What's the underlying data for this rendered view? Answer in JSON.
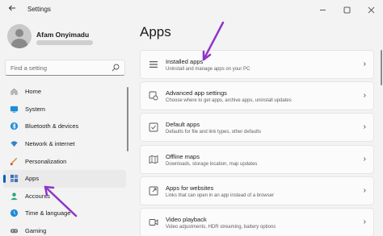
{
  "window": {
    "title": "Settings",
    "back_icon": "back-arrow-icon",
    "controls": [
      "minimize-icon",
      "maximize-icon",
      "close-icon"
    ]
  },
  "user": {
    "name": "Afam Onyimadu"
  },
  "search": {
    "placeholder": "Find a setting"
  },
  "nav": {
    "items": [
      {
        "label": "Home",
        "icon": "home-icon"
      },
      {
        "label": "System",
        "icon": "system-icon"
      },
      {
        "label": "Bluetooth & devices",
        "icon": "bluetooth-icon"
      },
      {
        "label": "Network & internet",
        "icon": "network-icon"
      },
      {
        "label": "Personalization",
        "icon": "personalization-icon"
      },
      {
        "label": "Apps",
        "icon": "apps-icon",
        "active": true
      },
      {
        "label": "Accounts",
        "icon": "accounts-icon"
      },
      {
        "label": "Time & language",
        "icon": "time-language-icon"
      },
      {
        "label": "Gaming",
        "icon": "gaming-icon"
      }
    ]
  },
  "main": {
    "title": "Apps",
    "cards": [
      {
        "title": "Installed apps",
        "desc": "Uninstall and manage apps on your PC",
        "icon": "installed-apps-icon"
      },
      {
        "title": "Advanced app settings",
        "desc": "Choose where to get apps, archive apps, uninstall updates",
        "icon": "advanced-app-settings-icon"
      },
      {
        "title": "Default apps",
        "desc": "Defaults for file and link types, other defaults",
        "icon": "default-apps-icon"
      },
      {
        "title": "Offline maps",
        "desc": "Downloads, storage location, map updates",
        "icon": "offline-maps-icon"
      },
      {
        "title": "Apps for websites",
        "desc": "Links that can open in an app instead of a browser",
        "icon": "apps-for-websites-icon"
      },
      {
        "title": "Video playback",
        "desc": "Video adjustments, HDR streaming, battery options",
        "icon": "video-playback-icon"
      }
    ]
  },
  "colors": {
    "accent": "#005fb8",
    "annotation_arrow": "#8e36c8"
  }
}
